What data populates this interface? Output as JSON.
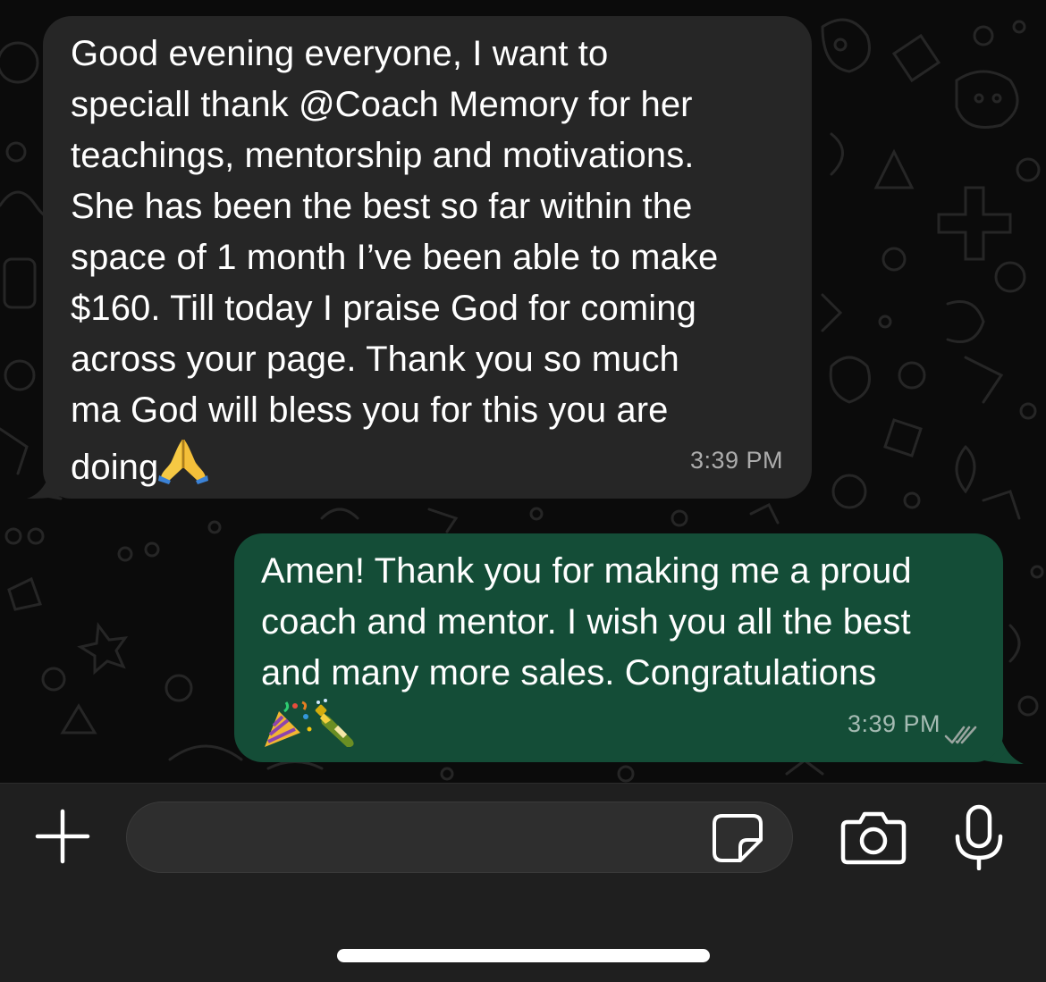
{
  "colors": {
    "chat_background": "#0b0b0b",
    "incoming_bubble": "#262626",
    "outgoing_bubble": "#144d37",
    "bottom_bar": "#1f1f1f",
    "input_background": "#2e2e2e",
    "text": "#ffffff",
    "timestamp": "#9e9e9e"
  },
  "messages": [
    {
      "direction": "incoming",
      "text": "Good evening everyone, I want to\nspeciall thank @Coach Memory for her\nteachings, mentorship and motivations.\nShe has been the best so far within the\nspace of 1 month I’ve been able to make\n$160. Till today I praise God for coming\nacross your page. Thank you so much\nma God will bless you for this you are\ndoing",
      "emoji_icon": "folded-hands-icon",
      "time": "3:39 PM"
    },
    {
      "direction": "outgoing",
      "text": "Amen! Thank you for making me a proud\ncoach and mentor. I wish you all the best\nand many more sales. Congratulations",
      "emoji_icons": [
        "party-popper-icon",
        "champagne-bottle-icon"
      ],
      "time": "3:39 PM",
      "status_icon": "double-check-read-icon"
    }
  ],
  "composer": {
    "value": "",
    "placeholder": "",
    "attach_icon": "plus-icon",
    "sticker_icon": "sticker-icon",
    "camera_icon": "camera-icon",
    "mic_icon": "microphone-icon"
  }
}
